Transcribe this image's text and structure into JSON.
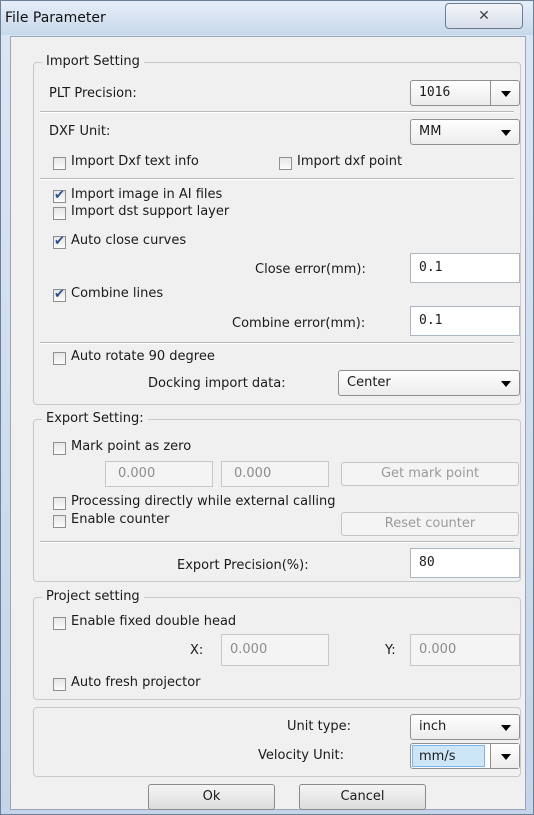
{
  "window": {
    "title": "File Parameter",
    "close_glyph": "✕"
  },
  "import": {
    "title": "Import Setting",
    "plt_precision_label": "PLT Precision:",
    "plt_precision_value": "1016",
    "dxf_unit_label": "DXF Unit:",
    "dxf_unit_value": "MM",
    "import_dxf_text_label": "Import Dxf text info",
    "import_dxf_point_label": "Import dxf point",
    "import_image_ai_label": "Import image in AI files",
    "import_dst_support_label": "Import dst support layer",
    "auto_close_label": "Auto close curves",
    "close_error_label": "Close error(mm):",
    "close_error_value": "0.1",
    "combine_lines_label": "Combine lines",
    "combine_error_label": "Combine error(mm):",
    "combine_error_value": "0.1",
    "auto_rotate_label": "Auto rotate 90 degree",
    "docking_label": "Docking import data:",
    "docking_value": "Center",
    "checked": {
      "import_dxf_text": false,
      "import_dxf_point": false,
      "import_image_ai": true,
      "import_dst_support": false,
      "auto_close": true,
      "combine_lines": true,
      "auto_rotate": false
    }
  },
  "export": {
    "title": "Export Setting:",
    "mark_point_label": "Mark point as zero",
    "mark_x_value": "0.000",
    "mark_y_value": "0.000",
    "get_mark_point_label": "Get mark point",
    "processing_label": "Processing directly while external calling",
    "enable_counter_label": "Enable counter",
    "reset_counter_label": "Reset counter",
    "export_precision_label": "Export Precision(%):",
    "export_precision_value": "80",
    "checked": {
      "mark_point": false,
      "processing": false,
      "enable_counter": false
    }
  },
  "project": {
    "title": "Project setting",
    "fixed_double_head_label": "Enable fixed double head",
    "x_label": "X:",
    "x_value": "0.000",
    "y_label": "Y:",
    "y_value": "0.000",
    "auto_fresh_label": "Auto fresh projector",
    "checked": {
      "fixed_double_head": false,
      "auto_fresh": false
    }
  },
  "units": {
    "unit_type_label": "Unit type:",
    "unit_type_value": "inch",
    "velocity_unit_label": "Velocity Unit:",
    "velocity_unit_value": "mm/s"
  },
  "buttons": {
    "ok": "Ok",
    "cancel": "Cancel"
  }
}
